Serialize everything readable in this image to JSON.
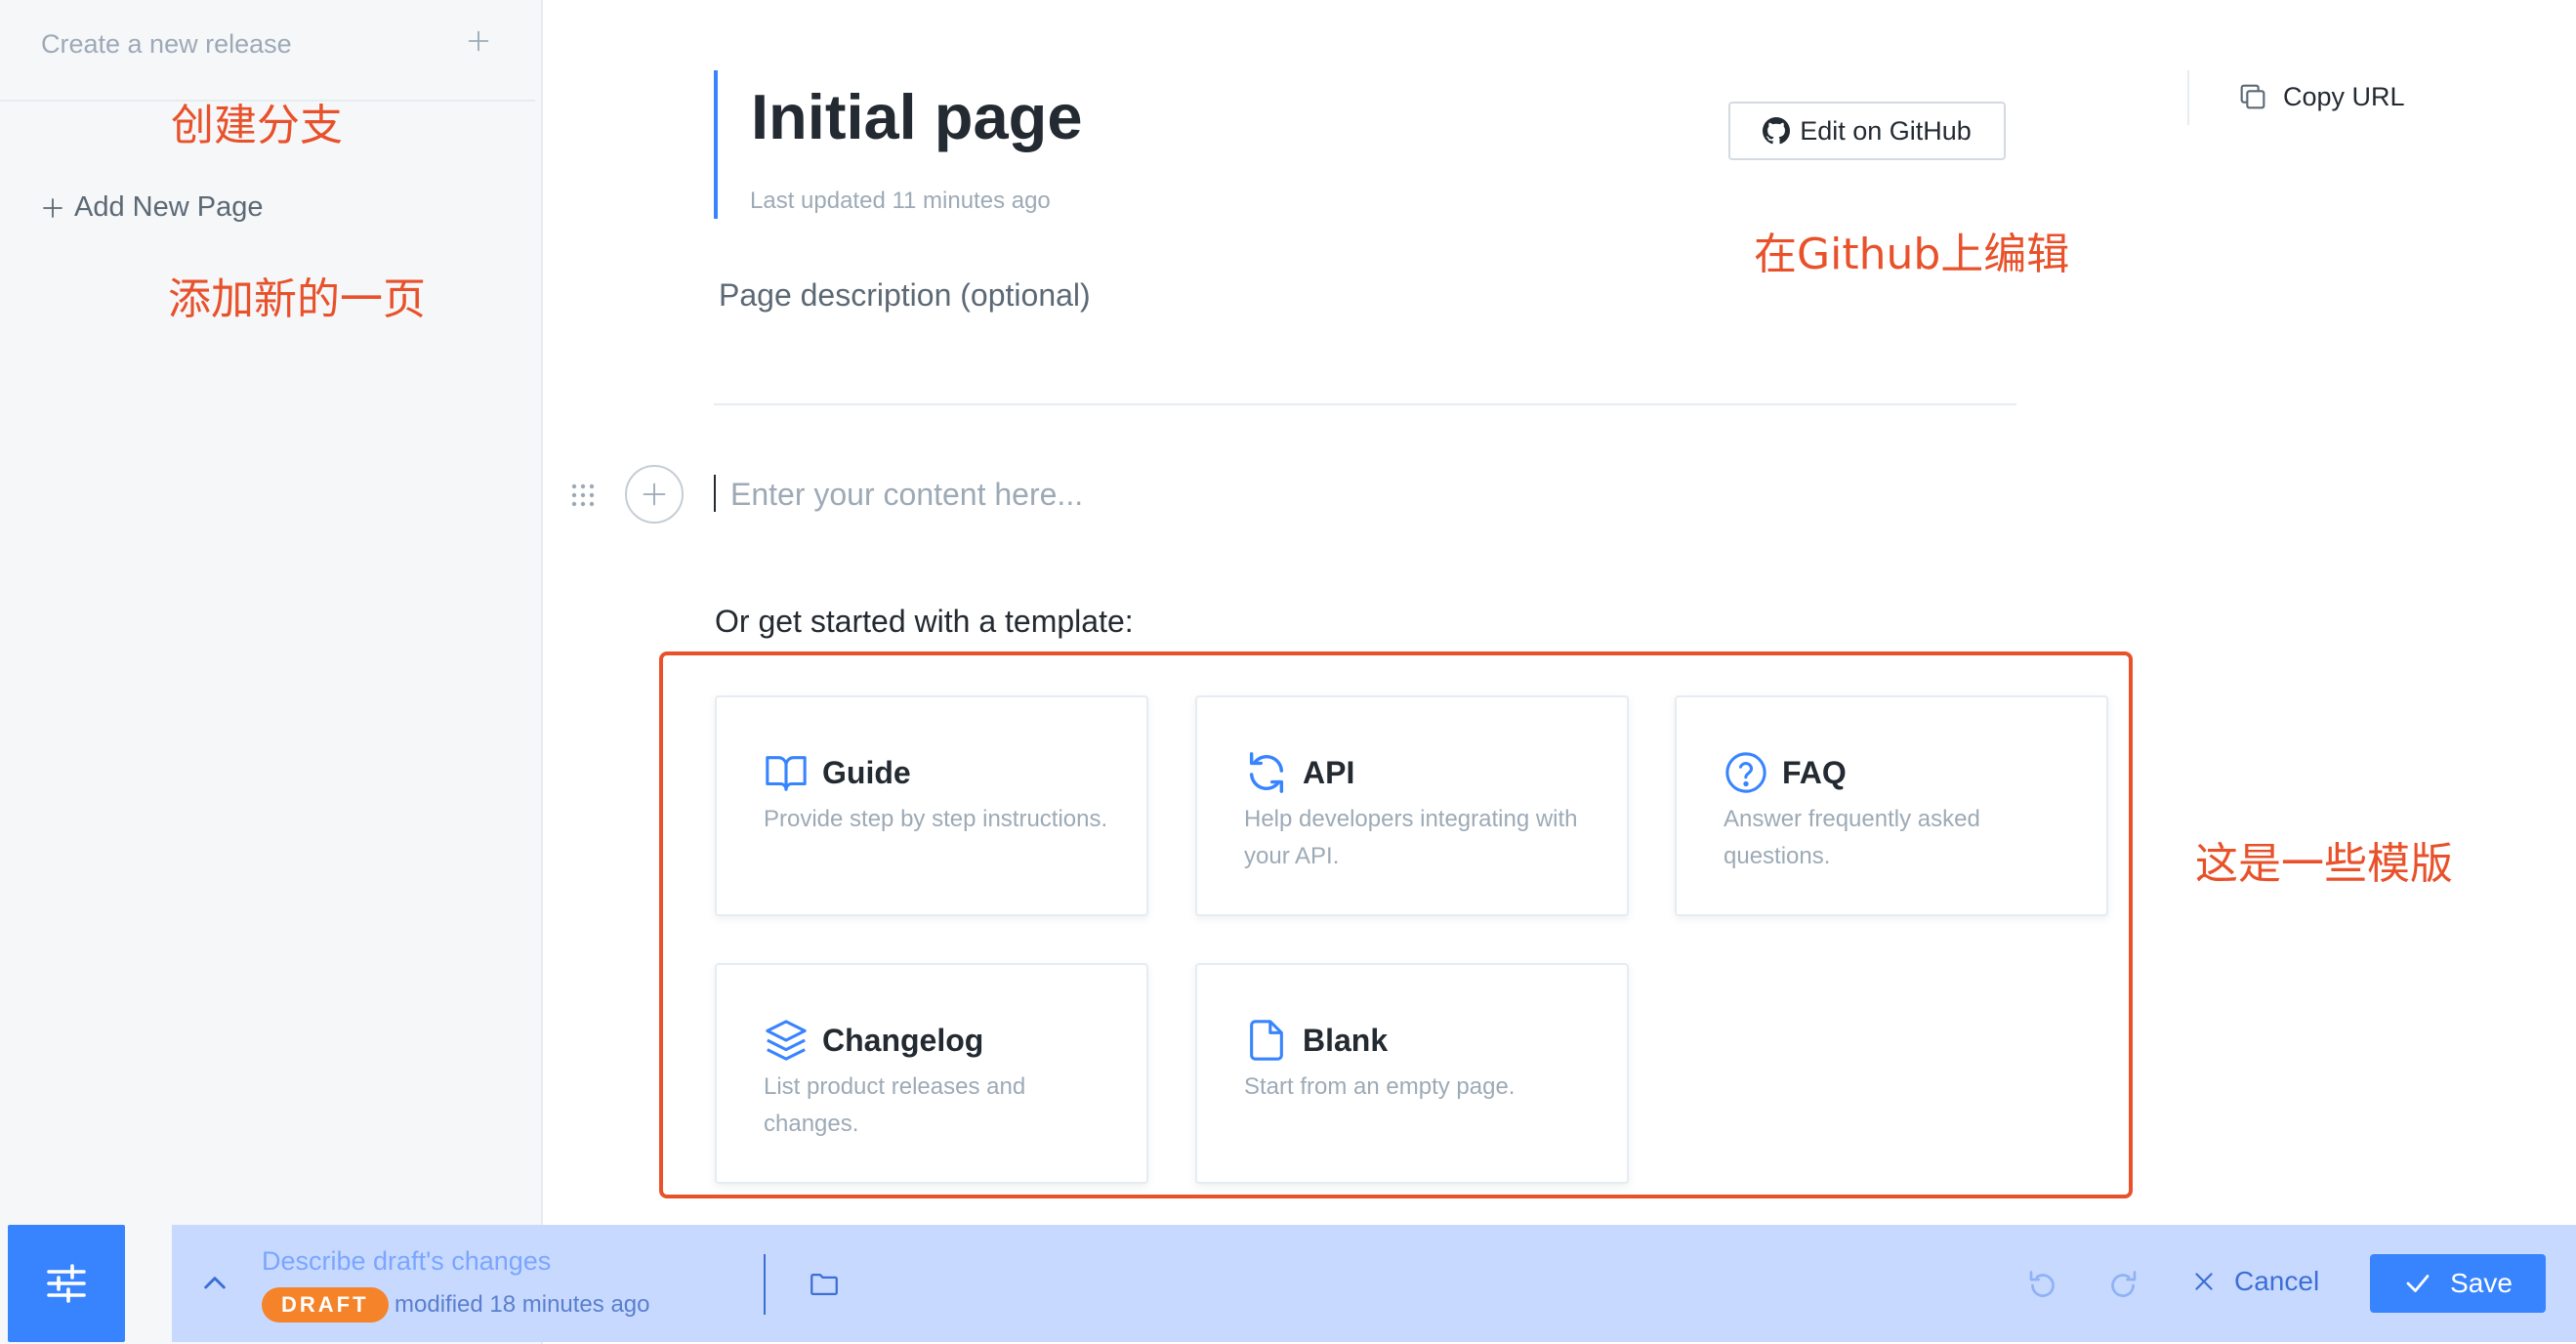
{
  "sidebar": {
    "release_label": "Create a new release",
    "add_page_label": "Add New Page"
  },
  "annotations": {
    "create_branch": "创建分支",
    "add_new_page": "添加新的一页",
    "edit_on_github": "在Github上编辑",
    "templates": "这是一些模版"
  },
  "page": {
    "title": "Initial page",
    "last_updated": "Last updated 11 minutes ago",
    "description_placeholder": "Page description (optional)",
    "content_placeholder": "Enter your content here..."
  },
  "header": {
    "edit_github_label": "Edit on GitHub",
    "copy_url_label": "Copy URL"
  },
  "templates": {
    "heading": "Or get started with a template:",
    "items": [
      {
        "title": "Guide",
        "desc": "Provide step by step instructions.",
        "icon": "book-open-icon"
      },
      {
        "title": "API",
        "desc": "Help developers integrating with your API.",
        "icon": "refresh-icon"
      },
      {
        "title": "FAQ",
        "desc": "Answer frequently asked questions.",
        "icon": "question-circle-icon"
      },
      {
        "title": "Changelog",
        "desc": "List product releases and changes.",
        "icon": "layers-icon"
      },
      {
        "title": "Blank",
        "desc": "Start from an empty page.",
        "icon": "file-icon"
      }
    ]
  },
  "draft_bar": {
    "describe_label": "Describe draft's changes",
    "badge": "DRAFT",
    "modified": "modified 18 minutes ago",
    "cancel_label": "Cancel",
    "save_label": "Save"
  },
  "colors": {
    "accent": "#3884ff",
    "annotation": "#e8512a",
    "badge": "#f5832a",
    "draft_bar_bg": "#c8d9ff"
  }
}
